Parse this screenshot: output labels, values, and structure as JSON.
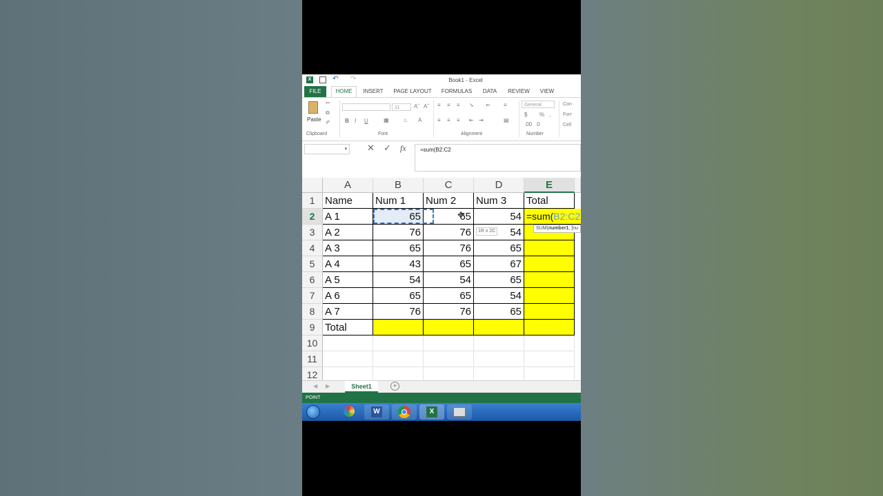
{
  "window": {
    "title": "Book1 - Excel"
  },
  "ribbon": {
    "tabs": [
      "FILE",
      "HOME",
      "INSERT",
      "PAGE LAYOUT",
      "FORMULAS",
      "DATA",
      "REVIEW",
      "VIEW"
    ],
    "active_tab": "HOME",
    "paste_label": "Paste",
    "font_size": "11",
    "number_format": "General",
    "groups": {
      "clipboard": "Clipboard",
      "font": "Font",
      "alignment": "Alignment",
      "number": "Number"
    },
    "styles": [
      "Con",
      "Forr",
      "Cell"
    ],
    "buttons": {
      "bold": "B",
      "italic": "I",
      "underline": "U"
    }
  },
  "formula_bar": {
    "fx": "fx",
    "value": "=sum(B2:C2"
  },
  "columns": [
    "A",
    "B",
    "C",
    "D",
    "E"
  ],
  "rows": [
    "1",
    "2",
    "3",
    "4",
    "5",
    "6",
    "7",
    "8",
    "9",
    "10",
    "11",
    "12"
  ],
  "table": {
    "headers": [
      "Name",
      "Num 1",
      "Num 2",
      "Num 3",
      "Total"
    ],
    "data": [
      [
        "A 1",
        "65",
        "65",
        "54"
      ],
      [
        "A 2",
        "76",
        "76",
        "54"
      ],
      [
        "A 3",
        "65",
        "76",
        "65"
      ],
      [
        "A 4",
        "43",
        "65",
        "67"
      ],
      [
        "A 5",
        "54",
        "54",
        "65"
      ],
      [
        "A 6",
        "65",
        "65",
        "54"
      ],
      [
        "A 7",
        "76",
        "76",
        "65"
      ]
    ],
    "total_label": "Total"
  },
  "editing": {
    "cell_text_prefix": "=sum(",
    "cell_text_ref": "B2:C2",
    "range_tooltip": "1R x 2C",
    "fn_tip_name": "SUM(",
    "fn_tip_arg": "number1",
    "fn_tip_rest": ", [nu"
  },
  "sheet_tab": "Sheet1",
  "status": "POINT",
  "colors": {
    "excel_green": "#217346",
    "highlight": "#ffff00",
    "ref_blue": "#1f7cd0"
  },
  "icons": [
    "excel-icon",
    "save-icon",
    "undo-icon",
    "redo-icon",
    "windows-start-icon",
    "paint-icon",
    "word-icon",
    "chrome-icon",
    "excel-taskbar-icon",
    "window-icon"
  ]
}
